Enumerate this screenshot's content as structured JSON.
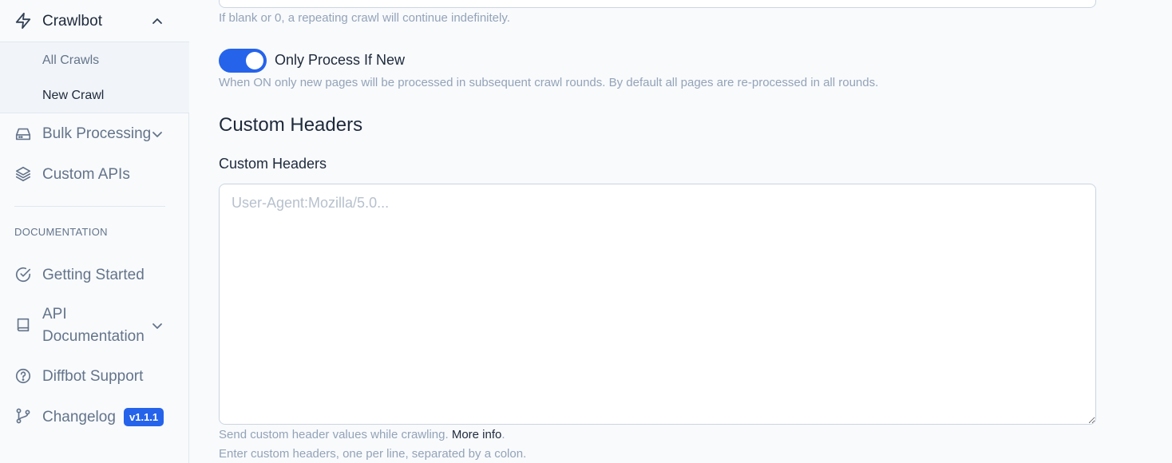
{
  "sidebar": {
    "crawlbot": {
      "label": "Crawlbot",
      "icon": "lightning-icon"
    },
    "crawlbot_sub": [
      {
        "label": "All Crawls"
      },
      {
        "label": "New Crawl"
      }
    ],
    "bulk_processing": {
      "label": "Bulk Processing",
      "icon": "drive-icon"
    },
    "custom_apis": {
      "label": "Custom APIs",
      "icon": "layers-icon"
    },
    "documentation_heading": "DOCUMENTATION",
    "getting_started": {
      "label": "Getting Started",
      "icon": "check-circle-icon"
    },
    "api_documentation": {
      "label": "API Documentation",
      "line1": "API",
      "line2": "Documentation",
      "icon": "book-icon"
    },
    "diffbot_support": {
      "label": "Diffbot Support",
      "icon": "help-circle-icon"
    },
    "changelog": {
      "label": "Changelog",
      "icon": "git-branch-icon",
      "version_badge": "v1.1.1"
    }
  },
  "main": {
    "repeat_help": "If blank or 0, a repeating crawl will continue indefinitely.",
    "only_process_toggle": {
      "label": "Only Process If New",
      "state": "on",
      "help": "When ON only new pages will be processed in subsequent crawl rounds. By default all pages are re-processed in all rounds."
    },
    "section_title": "Custom Headers",
    "custom_headers": {
      "label": "Custom Headers",
      "placeholder": "User-Agent:Mozilla/5.0...",
      "value": "",
      "help_prefix": "Send custom header values while crawling. ",
      "help_link": "More info",
      "help_suffix": ".",
      "help_line2": "Enter custom headers, one per line, separated by a colon."
    }
  },
  "colors": {
    "accent": "#2563eb",
    "sidebar_bg": "#f8fafc",
    "subnav_bg": "#f1f5f9",
    "muted_text": "#94a3b8"
  }
}
